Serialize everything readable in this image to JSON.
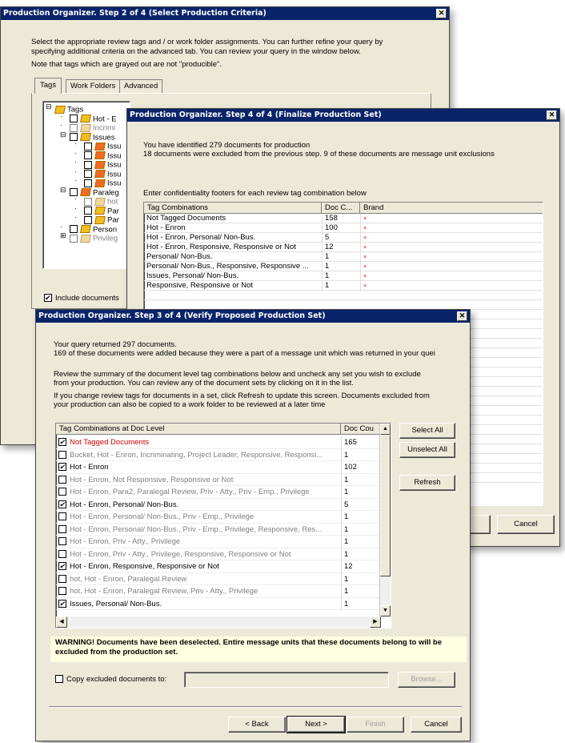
{
  "step2": {
    "title": "Production Organizer. Step 2 of 4 (Select Production Criteria)",
    "desc1": "Select the appropriate review tags and / or work folder assignments. You can further refine your query by",
    "desc2": "specifying additional criteria on the advanced tab. You can review your query in the window below.",
    "desc3": "Note that tags which are grayed out are not \"producible\".",
    "tabs": [
      "Tags",
      "Work Folders",
      "Advanced"
    ],
    "tree": [
      {
        "label": "Tags",
        "level": 0,
        "exp": "minus",
        "check": false,
        "icon": "tag"
      },
      {
        "label": "Hot - E",
        "level": 1,
        "exp": "",
        "check": true,
        "icon": "tag"
      },
      {
        "label": "Incrimi",
        "level": 1,
        "exp": "",
        "check": true,
        "icon": "tag-gray",
        "gray": true
      },
      {
        "label": "Issues",
        "level": 1,
        "exp": "minus",
        "check": true,
        "icon": "tag"
      },
      {
        "label": "Issu",
        "level": 2,
        "exp": "",
        "check": true,
        "icon": "tag-red"
      },
      {
        "label": "Issu",
        "level": 2,
        "exp": "",
        "check": true,
        "icon": "tag-red"
      },
      {
        "label": "Issu",
        "level": 2,
        "exp": "",
        "check": true,
        "icon": "tag-red"
      },
      {
        "label": "Issu",
        "level": 2,
        "exp": "",
        "check": true,
        "icon": "tag-red"
      },
      {
        "label": "Issu",
        "level": 2,
        "exp": "",
        "check": true,
        "icon": "tag-red"
      },
      {
        "label": "Paraleg",
        "level": 1,
        "exp": "minus",
        "check": true,
        "icon": "tag-red"
      },
      {
        "label": "hot",
        "level": 2,
        "exp": "",
        "check": true,
        "icon": "tag-gray",
        "gray": true
      },
      {
        "label": "Par",
        "level": 2,
        "exp": "",
        "check": true,
        "icon": "tag"
      },
      {
        "label": "Par",
        "level": 2,
        "exp": "",
        "check": true,
        "icon": "tag"
      },
      {
        "label": "Person",
        "level": 1,
        "exp": "",
        "check": true,
        "icon": "tag"
      },
      {
        "label": "Privileg",
        "level": 1,
        "exp": "plus",
        "check": true,
        "icon": "tag-gray",
        "gray": true
      }
    ],
    "include_label": "Include documents"
  },
  "step4": {
    "title": "Production Organizer. Step 4 of 4 (Finalize Production Set)",
    "line1": "You have identified 279 documents for production",
    "line2": "18 documents were excluded from the previous step. 9 of these documents are message unit exclusions",
    "prompt": "Enter confidentiality footers for each review tag combination below",
    "columns": [
      "Tag Combinations",
      "Doc C...",
      "Brand"
    ],
    "rows": [
      {
        "tag": "Not Tagged Documents",
        "count": "158"
      },
      {
        "tag": "Hot - Enron",
        "count": "100"
      },
      {
        "tag": "Hot - Enron, Personal/ Non-Bus.",
        "count": "5"
      },
      {
        "tag": "Hot - Enron, Responsive, Responsive or Not",
        "count": "12"
      },
      {
        "tag": "Personal/ Non-Bus.",
        "count": "1"
      },
      {
        "tag": "Personal/ Non-Bus., Responsive, Responsive ...",
        "count": "1"
      },
      {
        "tag": "Issues, Personal/ Non-Bus.",
        "count": "1"
      },
      {
        "tag": "Responsive, Responsive or Not",
        "count": "1"
      }
    ],
    "cancel": "Cancel"
  },
  "step3": {
    "title": "Production Organizer. Step 3 of 4 (Verify Proposed Production Set)",
    "line1": "Your query returned 297 documents.",
    "line2": "169 of these documents were added because they were a part of a message unit which was returned in your quei",
    "line3": "Review the summary of the document level tag combinations below and uncheck any set you wish to exclude",
    "line4": "from your production. You can review any of the document sets by clicking on it in the list.",
    "line5": "If you change review tags for documents in a set, click Refresh to update this screen. Documents excluded from",
    "line6": "your production can also be copied to a work folder to be reviewed at a later time",
    "columns": [
      "Tag Combinations at Doc Level",
      "Doc Cou"
    ],
    "rows": [
      {
        "tag": "Not Tagged Documents",
        "count": "165",
        "checked": true,
        "style": "red"
      },
      {
        "tag": "Bucket, Hot - Enron, Incriminating, Project Leader, Responsive, Responsi...",
        "count": "1",
        "checked": false,
        "style": "gray"
      },
      {
        "tag": "Hot - Enron",
        "count": "102",
        "checked": true,
        "style": ""
      },
      {
        "tag": "Hot - Enron, Not Responsive, Responsive or Not",
        "count": "1",
        "checked": false,
        "style": "gray"
      },
      {
        "tag": "Hot - Enron, Para2, Paralegal Review, Priv - Atty., Priv - Emp., Privilege",
        "count": "1",
        "checked": false,
        "style": "gray"
      },
      {
        "tag": "Hot - Enron, Personal/ Non-Bus.",
        "count": "5",
        "checked": true,
        "style": ""
      },
      {
        "tag": "Hot - Enron, Personal/ Non-Bus., Priv - Emp., Privilege",
        "count": "1",
        "checked": false,
        "style": "gray"
      },
      {
        "tag": "Hot - Enron, Personal/ Non-Bus., Priv - Emp., Privilege, Responsive, Res...",
        "count": "1",
        "checked": false,
        "style": "gray"
      },
      {
        "tag": "Hot - Enron, Priv - Atty., Privilege",
        "count": "1",
        "checked": false,
        "style": "gray"
      },
      {
        "tag": "Hot - Enron, Priv - Atty., Privilege, Responsive, Responsive or Not",
        "count": "1",
        "checked": false,
        "style": "gray"
      },
      {
        "tag": "Hot - Enron, Responsive, Responsive or Not",
        "count": "12",
        "checked": true,
        "style": ""
      },
      {
        "tag": "hot, Hot - Enron, Paralegal Review",
        "count": "1",
        "checked": false,
        "style": "gray"
      },
      {
        "tag": "hot, Hot - Enron, Paralegal Review, Priv - Atty., Privilege",
        "count": "1",
        "checked": false,
        "style": "gray"
      },
      {
        "tag": "Issues, Personal/ Non-Bus.",
        "count": "1",
        "checked": true,
        "style": ""
      }
    ],
    "select_all": "Select All",
    "unselect_all": "Unselect All",
    "refresh": "Refresh",
    "warning": "WARNING! Documents have been deselected. Entire message units that these documents belong to will be excluded from the production set.",
    "copy_label": "Copy excluded documents to:",
    "browse": "Browse...",
    "back": "< Back",
    "next": "Next >",
    "finish": "Finish",
    "cancel": "Cancel"
  },
  "colors": {
    "title_bar": "#0a246a",
    "dialog": "#ece9d8",
    "warning_bg": "#ffffe1",
    "red_text": "#cc0000"
  }
}
